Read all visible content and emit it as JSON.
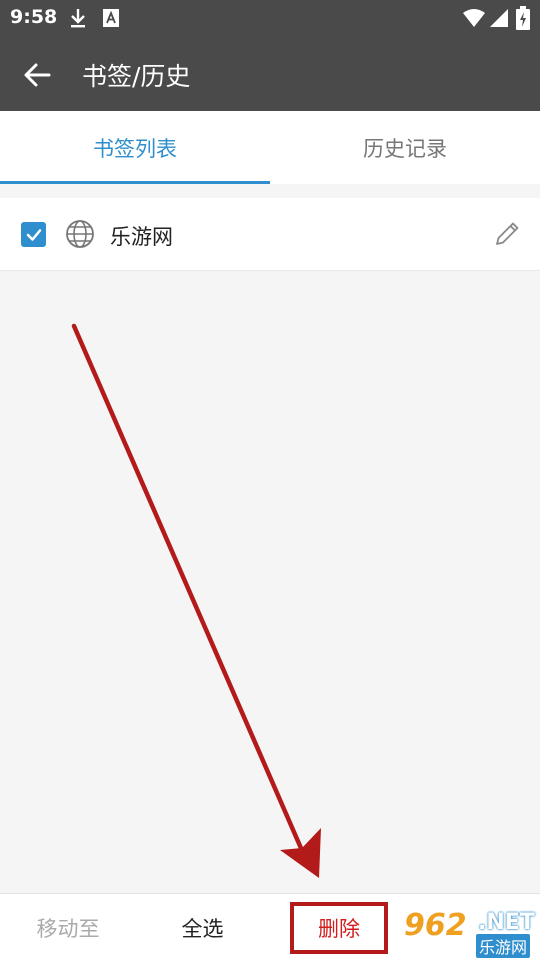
{
  "status_bar": {
    "time": "9:58",
    "icons": [
      "download-icon",
      "font-app-icon",
      "wifi-icon",
      "signal-icon",
      "battery-charging-icon"
    ]
  },
  "app_bar": {
    "title": "书签/历史",
    "back_icon": "arrow-left-icon"
  },
  "tabs": [
    {
      "label": "书签列表",
      "active": true
    },
    {
      "label": "历史记录",
      "active": false
    }
  ],
  "bookmarks": [
    {
      "title": "乐游网",
      "checked": true,
      "icon": "globe-icon"
    }
  ],
  "bottom_bar": {
    "move_label": "移动至",
    "select_all_label": "全选",
    "delete_label": "删除"
  },
  "watermark": {
    "number": "962",
    "suffix": ".NET",
    "name": "乐游网"
  },
  "colors": {
    "accent": "#2f8fce",
    "app_bar": "#4a4a4a",
    "annotation_red": "#b31a1a"
  }
}
